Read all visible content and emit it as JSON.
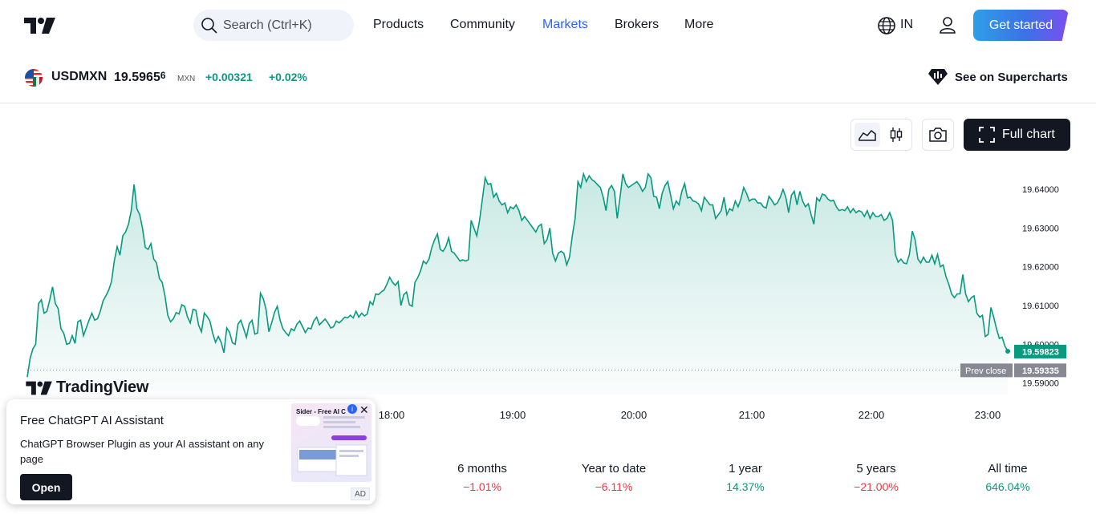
{
  "nav": {
    "search_placeholder": "Search (Ctrl+K)",
    "links": [
      "Products",
      "Community",
      "Markets",
      "Brokers",
      "More"
    ],
    "active_link": "Markets",
    "language": "IN",
    "get_started": "Get started"
  },
  "symbol": {
    "name": "USDMXN",
    "price_main": "19.5965",
    "price_fraction": "6",
    "currency": "MXN",
    "change": "+0.00321",
    "change_percent": "+0.02%",
    "supercharts_label": "See on Supercharts"
  },
  "chart_controls": {
    "full_chart_label": "Full chart"
  },
  "chart_data": {
    "type": "area",
    "x_ticks": [
      "18:00",
      "19:00",
      "20:00",
      "21:00",
      "22:00",
      "23:00"
    ],
    "y_ticks": [
      "19.64000",
      "19.63000",
      "19.62000",
      "19.61000",
      "19.60000",
      "19.59000"
    ],
    "ylim": [
      19.587,
      19.6475
    ],
    "last_value": "19.59823",
    "prev_close": 19.59335,
    "prev_close_label": "Prev close",
    "prev_close_value": "19.59335",
    "watermark": "TradingView",
    "series": [
      {
        "values": [
          19.5915,
          19.5963,
          19.5988,
          19.6,
          19.6105,
          19.6115,
          19.608,
          19.6085,
          19.6115,
          19.6148,
          19.6105,
          19.6092,
          19.604,
          19.6028,
          19.6,
          19.6002,
          19.6022,
          19.6002,
          19.6058,
          19.6062,
          19.6022,
          19.6042,
          19.6062,
          19.608,
          19.6062,
          19.6066,
          19.6085,
          19.6112,
          19.6125,
          19.614,
          19.6162,
          19.6216,
          19.6252,
          19.623,
          19.628,
          19.629,
          19.631,
          19.6345,
          19.6413,
          19.635,
          19.6335,
          19.63,
          19.625,
          19.6245,
          19.626,
          19.622,
          19.621,
          19.617,
          19.616,
          19.6125,
          19.6075,
          19.6058,
          19.6066,
          19.6082,
          19.6078,
          19.6102,
          19.6098,
          19.6071,
          19.6055,
          19.609,
          19.6088,
          19.6049,
          19.6032,
          19.608,
          19.6072,
          19.606,
          19.6028,
          19.6005,
          19.602,
          19.6005,
          19.5978,
          19.6042,
          19.6031,
          19.6004,
          19.6,
          19.6052,
          19.6062,
          19.6041,
          19.6018,
          19.6053,
          19.6062,
          19.6026,
          19.6029,
          19.6132,
          19.6118,
          19.609,
          19.6032,
          19.6055,
          19.6082,
          19.6098,
          19.6062,
          19.604,
          19.603,
          19.6022,
          19.604,
          19.6035,
          19.6052,
          19.606,
          19.6045,
          19.603,
          19.6042,
          19.604,
          19.606,
          19.607,
          19.605,
          19.6058,
          19.6065,
          19.6055,
          19.6042,
          19.6045,
          19.606,
          19.6055,
          19.6062,
          19.607,
          19.6068,
          19.6075,
          19.6068,
          19.6085,
          19.607,
          19.608,
          19.6073,
          19.6078,
          19.611,
          19.6102,
          19.613,
          19.6128,
          19.6135,
          19.614,
          19.6155,
          19.6173,
          19.616,
          19.6152,
          19.6162,
          19.61,
          19.6128,
          19.6135,
          19.6102,
          19.6098,
          19.616,
          19.6172,
          19.619,
          19.6215,
          19.6208,
          19.622,
          19.625,
          19.627,
          19.6285,
          19.6245,
          19.624,
          19.6252,
          19.6275,
          19.624,
          19.6235,
          19.6225,
          19.6215,
          19.6218,
          19.6215,
          19.6218,
          19.632,
          19.63,
          19.628,
          19.632,
          19.6375,
          19.643,
          19.6413,
          19.6415,
          19.638,
          19.639,
          19.637,
          19.636,
          19.6365,
          19.634,
          19.6355,
          19.635,
          19.636,
          19.6345,
          19.632,
          19.633,
          19.632,
          19.631,
          19.63,
          19.629,
          19.6305,
          19.631,
          19.626,
          19.627,
          19.63,
          19.6235,
          19.6215,
          19.6235,
          19.624,
          19.6235,
          19.6205,
          19.6225,
          19.628,
          19.6325,
          19.642,
          19.6405,
          19.644,
          19.642,
          19.6435,
          19.6425,
          19.642,
          19.6412,
          19.6405,
          19.638,
          19.6345,
          19.64,
          19.641,
          19.6395,
          19.6325,
          19.638,
          19.644,
          19.6415,
          19.6405,
          19.641,
          19.6415,
          19.642,
          19.641,
          19.6395,
          19.6405,
          19.644,
          19.643,
          19.6382,
          19.638,
          19.635,
          19.639,
          19.641,
          19.642,
          19.6385,
          19.635,
          19.637,
          19.636,
          19.6395,
          19.6415,
          19.6378,
          19.638,
          19.637,
          19.6368,
          19.6362,
          19.6345,
          19.638,
          19.637,
          19.636,
          19.636,
          19.6325,
          19.6335,
          19.6345,
          19.638,
          19.6335,
          19.635,
          19.6345,
          19.637,
          19.6355,
          19.6375,
          19.6405,
          19.639,
          19.637,
          19.6375,
          19.6375,
          19.6365,
          19.6365,
          19.6355,
          19.6352,
          19.6382,
          19.6372,
          19.636,
          19.6365,
          19.638,
          19.64,
          19.638,
          19.634,
          19.6385,
          19.6395,
          19.636,
          19.6395,
          19.637,
          19.6355,
          19.6363,
          19.6335,
          19.631,
          19.6378,
          19.637,
          19.6388,
          19.6385,
          19.6375,
          19.637,
          19.6372,
          19.6355,
          19.6345,
          19.6348,
          19.6345,
          19.6355,
          19.634,
          19.635,
          19.634,
          19.6345,
          19.6342,
          19.633,
          19.6345,
          19.6325,
          19.634,
          19.633,
          19.633,
          19.6335,
          19.632,
          19.6325,
          19.634,
          19.632,
          19.6232,
          19.6212,
          19.622,
          19.621,
          19.6208,
          19.6232,
          19.6292,
          19.627,
          19.622,
          19.621,
          19.6225,
          19.6212,
          19.6212,
          19.623,
          19.6208,
          19.6232,
          19.62,
          19.6205,
          19.6175,
          19.6155,
          19.613,
          19.612,
          19.613,
          19.613,
          19.618,
          19.613,
          19.611,
          19.612,
          19.6125,
          19.608,
          19.607,
          19.6075,
          19.602,
          19.6025,
          19.6095,
          19.607,
          19.604,
          19.6015,
          19.6018,
          19.5995,
          19.5982
        ]
      }
    ]
  },
  "periods": [
    {
      "label": "6 months",
      "value": "−1.01%",
      "dir": "neg"
    },
    {
      "label": "Year to date",
      "value": "−6.11%",
      "dir": "neg"
    },
    {
      "label": "1 year",
      "value": "14.37%",
      "dir": "pos"
    },
    {
      "label": "5 years",
      "value": "−21.00%",
      "dir": "neg"
    },
    {
      "label": "All time",
      "value": "646.04%",
      "dir": "pos"
    }
  ],
  "ad": {
    "title": "Free ChatGPT AI Assistant",
    "description": "ChatGPT Browser Plugin as your AI assistant on any page",
    "open_label": "Open",
    "thumb_title": "Sider - Free AI C",
    "tag": "AD"
  },
  "colors": {
    "accent": "#2962ff",
    "line": "#089981",
    "positive": "#089981",
    "negative": "#f23645",
    "prev_close_bg": "#868993"
  },
  "icons": [
    "tradingview-logo-icon",
    "search-icon",
    "globe-icon",
    "user-icon",
    "usd-mxn-flag-icon",
    "supercharts-icon",
    "area-chart-icon",
    "candles-icon",
    "camera-icon",
    "fullscreen-icon",
    "info-icon",
    "close-icon"
  ]
}
